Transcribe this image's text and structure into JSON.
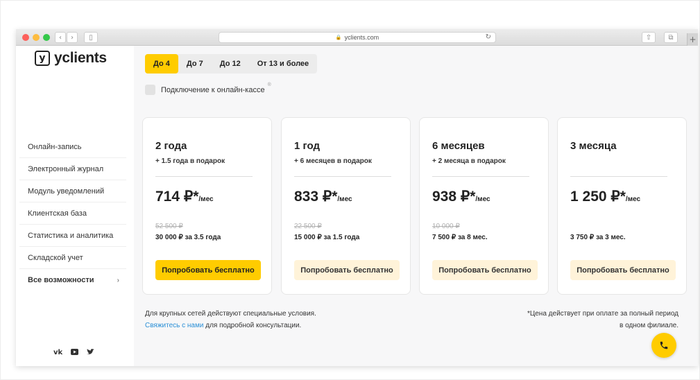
{
  "browser": {
    "url": "yclients.com"
  },
  "brand": {
    "name": "yclients",
    "mark": "y"
  },
  "sidebar": {
    "items": [
      {
        "label": "Онлайн-запись"
      },
      {
        "label": "Электронный журнал"
      },
      {
        "label": "Модуль уведомлений"
      },
      {
        "label": "Клиентская база"
      },
      {
        "label": "Статистика и аналитика"
      },
      {
        "label": "Складской учет"
      },
      {
        "label": "Все возможности"
      }
    ],
    "social": [
      "vk-icon",
      "youtube-icon",
      "twitter-icon"
    ]
  },
  "tabs": [
    {
      "label": "До 4",
      "active": true
    },
    {
      "label": "До 7",
      "active": false
    },
    {
      "label": "До 12",
      "active": false
    },
    {
      "label": "От 13 и более",
      "active": false
    }
  ],
  "option": {
    "label": "Подключение к онлайн-кассе",
    "checked": false
  },
  "plans": [
    {
      "period": "2 года",
      "bonus": "+ 1.5 года в подарок",
      "price": "714 ₽*",
      "unit": "/мес",
      "old_price": "52 500 ₽",
      "total": "30 000 ₽ за 3.5 года",
      "button": "Попробовать бесплатно"
    },
    {
      "period": "1 год",
      "bonus": "+ 6 месяцев в подарок",
      "price": "833 ₽*",
      "unit": "/мес",
      "old_price": "22 500 ₽",
      "total": "15 000 ₽ за 1.5 года",
      "button": "Попробовать бесплатно"
    },
    {
      "period": "6 месяцев",
      "bonus": "+ 2 месяца в подарок",
      "price": "938 ₽*",
      "unit": "/мес",
      "old_price": "10 000 ₽",
      "total": "7 500 ₽ за 8 мес.",
      "button": "Попробовать бесплатно"
    },
    {
      "period": "3 месяца",
      "bonus": "",
      "price": "1 250 ₽*",
      "unit": "/мес",
      "old_price": "",
      "total": "3 750 ₽ за 3 мес.",
      "button": "Попробовать бесплатно"
    }
  ],
  "footer": {
    "left_line1": "Для крупных сетей действуют специальные условия.",
    "left_link": "Свяжитесь с нами",
    "left_line2_rest": " для подробной консультации.",
    "right_line1": "*Цена действует при оплате за полный период",
    "right_line2": "в одном филиале."
  },
  "colors": {
    "accent": "#ffcc00",
    "accent_soft": "#fff3d9",
    "link": "#2a8fd6"
  }
}
